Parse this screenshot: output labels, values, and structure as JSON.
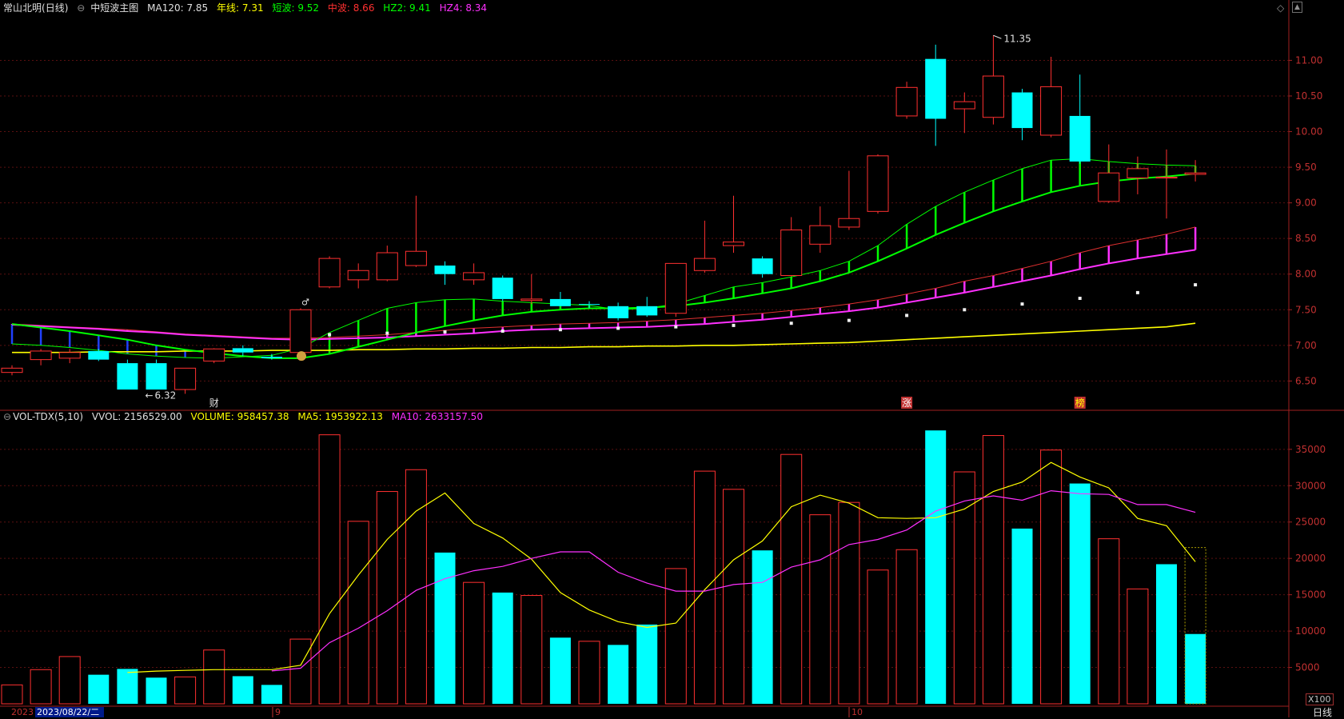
{
  "header": {
    "stock": "常山北明",
    "period": "(日线)",
    "indicator": "中短波主图",
    "ma120": {
      "label": "MA120:",
      "value": "7.85",
      "color": "#e0e0e0"
    },
    "nianxian": {
      "label": "年线:",
      "value": "7.31",
      "color": "#ffff00"
    },
    "duanbo": {
      "label": "短波:",
      "value": "9.52",
      "color": "#00ff00"
    },
    "zhongbo": {
      "label": "中波:",
      "value": "8.66",
      "color": "#ff3030"
    },
    "hz2": {
      "label": "HZ2:",
      "value": "9.41",
      "color": "#00ff00"
    },
    "hz4": {
      "label": "HZ4:",
      "value": "8.34",
      "color": "#ff30ff"
    }
  },
  "vol_header": {
    "name": "VOL-TDX(5,10)",
    "vvol": "VVOL: 2156529.00",
    "volume": {
      "text": "VOLUME: 958457.38",
      "color": "#ffff00"
    },
    "ma5": {
      "text": "MA5: 1953922.13",
      "color": "#ffff00"
    },
    "ma10": {
      "text": "MA10: 2633157.50",
      "color": "#ff30ff"
    }
  },
  "corner": {
    "scale": "X100",
    "period_label": "日线"
  },
  "annotations": {
    "high": "11.35",
    "low": "6.32",
    "marks": [
      "财",
      "涨",
      "榜"
    ]
  },
  "date_axis": {
    "start": "2023",
    "cursor_date": "2023/08/22/二",
    "month_9": "9",
    "month_10": "10"
  },
  "chart_data": [
    {
      "type": "candlestick",
      "ylim": [
        6.1,
        11.6
      ],
      "y_ticks": [
        "6.50",
        "7.00",
        "7.50",
        "8.00",
        "8.50",
        "9.00",
        "9.50",
        "10.00",
        "10.50",
        "11.00"
      ],
      "candles": [
        {
          "o": 6.62,
          "h": 6.72,
          "l": 6.58,
          "c": 6.68
        },
        {
          "o": 6.8,
          "h": 6.95,
          "l": 6.72,
          "c": 6.92
        },
        {
          "o": 6.82,
          "h": 6.95,
          "l": 6.75,
          "c": 6.9
        },
        {
          "o": 6.92,
          "h": 6.95,
          "l": 6.78,
          "c": 6.8
        },
        {
          "o": 6.75,
          "h": 6.8,
          "l": 6.38,
          "c": 6.38
        },
        {
          "o": 6.75,
          "h": 6.8,
          "l": 6.38,
          "c": 6.38
        },
        {
          "o": 6.38,
          "h": 6.68,
          "l": 6.32,
          "c": 6.68
        },
        {
          "o": 6.78,
          "h": 6.96,
          "l": 6.75,
          "c": 6.95
        },
        {
          "o": 6.96,
          "h": 7.0,
          "l": 6.85,
          "c": 6.9
        },
        {
          "o": 6.84,
          "h": 6.88,
          "l": 6.8,
          "c": 6.82
        },
        {
          "o": 6.9,
          "h": 7.52,
          "l": 6.85,
          "c": 7.5
        },
        {
          "o": 7.82,
          "h": 8.25,
          "l": 7.8,
          "c": 8.22
        },
        {
          "o": 7.92,
          "h": 8.15,
          "l": 7.8,
          "c": 8.05
        },
        {
          "o": 7.92,
          "h": 8.4,
          "l": 7.9,
          "c": 8.3
        },
        {
          "o": 8.12,
          "h": 9.1,
          "l": 8.1,
          "c": 8.32
        },
        {
          "o": 8.12,
          "h": 8.18,
          "l": 7.85,
          "c": 8.0
        },
        {
          "o": 7.92,
          "h": 8.15,
          "l": 7.85,
          "c": 8.02
        },
        {
          "o": 7.95,
          "h": 7.98,
          "l": 7.62,
          "c": 7.65
        },
        {
          "o": 7.63,
          "h": 8.0,
          "l": 7.58,
          "c": 7.65
        },
        {
          "o": 7.65,
          "h": 7.75,
          "l": 7.55,
          "c": 7.55
        },
        {
          "o": 7.58,
          "h": 7.62,
          "l": 7.52,
          "c": 7.57
        },
        {
          "o": 7.55,
          "h": 7.6,
          "l": 7.35,
          "c": 7.38
        },
        {
          "o": 7.55,
          "h": 7.68,
          "l": 7.4,
          "c": 7.42
        },
        {
          "o": 7.45,
          "h": 8.15,
          "l": 7.4,
          "c": 8.15
        },
        {
          "o": 8.05,
          "h": 8.75,
          "l": 8.02,
          "c": 8.22
        },
        {
          "o": 8.4,
          "h": 9.1,
          "l": 8.3,
          "c": 8.45
        },
        {
          "o": 8.22,
          "h": 8.25,
          "l": 7.95,
          "c": 8.0
        },
        {
          "o": 7.98,
          "h": 8.8,
          "l": 7.96,
          "c": 8.62
        },
        {
          "o": 8.42,
          "h": 8.95,
          "l": 8.3,
          "c": 8.68
        },
        {
          "o": 8.66,
          "h": 9.45,
          "l": 8.62,
          "c": 8.78
        },
        {
          "o": 8.88,
          "h": 9.68,
          "l": 8.85,
          "c": 9.66
        },
        {
          "o": 10.22,
          "h": 10.7,
          "l": 10.18,
          "c": 10.62
        },
        {
          "o": 11.02,
          "h": 11.22,
          "l": 9.8,
          "c": 10.18
        },
        {
          "o": 10.32,
          "h": 10.55,
          "l": 9.98,
          "c": 10.42
        },
        {
          "o": 10.2,
          "h": 11.35,
          "l": 10.1,
          "c": 10.78
        },
        {
          "o": 10.55,
          "h": 10.6,
          "l": 9.88,
          "c": 10.05
        },
        {
          "o": 9.95,
          "h": 11.05,
          "l": 9.92,
          "c": 10.63
        },
        {
          "o": 10.22,
          "h": 10.8,
          "l": 9.55,
          "c": 9.58
        },
        {
          "o": 9.02,
          "h": 9.82,
          "l": 9.0,
          "c": 9.42
        },
        {
          "o": 9.35,
          "h": 9.65,
          "l": 9.12,
          "c": 9.48
        },
        {
          "o": 9.35,
          "h": 9.75,
          "l": 8.78,
          "c": 9.36
        },
        {
          "o": 9.4,
          "h": 9.6,
          "l": 9.3,
          "c": 9.42
        }
      ],
      "series": {
        "nianxian": [
          6.9,
          6.9,
          6.9,
          6.91,
          6.91,
          6.91,
          6.92,
          6.92,
          6.92,
          6.93,
          6.93,
          6.93,
          6.94,
          6.94,
          6.95,
          6.95,
          6.96,
          6.96,
          6.97,
          6.97,
          6.98,
          6.98,
          6.99,
          6.99,
          7.0,
          7.0,
          7.01,
          7.02,
          7.03,
          7.04,
          7.06,
          7.08,
          7.1,
          7.12,
          7.14,
          7.16,
          7.18,
          7.2,
          7.22,
          7.24,
          7.26,
          7.31
        ],
        "ma120": [
          null,
          null,
          null,
          null,
          null,
          null,
          null,
          null,
          null,
          null,
          null,
          7.15,
          7.16,
          7.17,
          7.18,
          7.19,
          7.2,
          7.2,
          7.21,
          7.22,
          7.23,
          7.24,
          7.25,
          7.26,
          7.27,
          7.28,
          7.29,
          7.31,
          7.33,
          7.35,
          7.38,
          7.42,
          7.46,
          7.5,
          7.54,
          7.58,
          7.62,
          7.66,
          7.7,
          7.74,
          7.8,
          7.85
        ],
        "duanbo": [
          7.02,
          7.0,
          6.97,
          6.93,
          6.88,
          6.85,
          6.83,
          6.82,
          6.84,
          6.86,
          6.96,
          7.18,
          7.35,
          7.52,
          7.6,
          7.64,
          7.65,
          7.62,
          7.6,
          7.58,
          7.56,
          7.5,
          7.52,
          7.58,
          7.7,
          7.82,
          7.88,
          7.96,
          8.05,
          8.18,
          8.4,
          8.7,
          8.95,
          9.15,
          9.32,
          9.48,
          9.6,
          9.62,
          9.58,
          9.55,
          9.53,
          9.52
        ],
        "hz2": [
          7.3,
          7.25,
          7.2,
          7.14,
          7.08,
          7.0,
          6.94,
          6.89,
          6.85,
          6.82,
          6.82,
          6.88,
          6.98,
          7.08,
          7.18,
          7.27,
          7.35,
          7.42,
          7.47,
          7.5,
          7.52,
          7.52,
          7.53,
          7.55,
          7.6,
          7.66,
          7.73,
          7.8,
          7.9,
          8.02,
          8.18,
          8.36,
          8.55,
          8.72,
          8.88,
          9.02,
          9.15,
          9.24,
          9.3,
          9.34,
          9.37,
          9.41
        ],
        "zhongbo": [
          7.3,
          7.28,
          7.26,
          7.24,
          7.22,
          7.19,
          7.16,
          7.14,
          7.12,
          7.1,
          7.1,
          7.11,
          7.13,
          7.15,
          7.18,
          7.21,
          7.24,
          7.26,
          7.28,
          7.3,
          7.31,
          7.32,
          7.34,
          7.36,
          7.39,
          7.42,
          7.45,
          7.49,
          7.53,
          7.58,
          7.64,
          7.72,
          7.8,
          7.9,
          7.98,
          8.08,
          8.18,
          8.3,
          8.4,
          8.48,
          8.56,
          8.66
        ],
        "hz4": [
          7.29,
          7.27,
          7.25,
          7.23,
          7.2,
          7.18,
          7.15,
          7.13,
          7.11,
          7.09,
          7.08,
          7.09,
          7.1,
          7.11,
          7.13,
          7.15,
          7.17,
          7.2,
          7.22,
          7.23,
          7.24,
          7.25,
          7.26,
          7.28,
          7.3,
          7.33,
          7.36,
          7.4,
          7.44,
          7.48,
          7.53,
          7.6,
          7.67,
          7.74,
          7.82,
          7.9,
          7.98,
          8.07,
          8.15,
          8.22,
          8.28,
          8.34
        ]
      }
    },
    {
      "type": "bar",
      "title": "VOL-TDX(5,10)",
      "ylim": [
        0,
        38500
      ],
      "y_ticks": [
        "5000",
        "10000",
        "15000",
        "20000",
        "25000",
        "30000",
        "35000"
      ],
      "volumes": [
        2600,
        4700,
        6500,
        4000,
        4800,
        3600,
        3700,
        7400,
        3800,
        2600,
        8900,
        37000,
        25100,
        29200,
        32200,
        20800,
        16700,
        15300,
        14900,
        9100,
        8600,
        8100,
        10900,
        18600,
        32000,
        29500,
        21100,
        34300,
        26000,
        27700,
        18400,
        21200,
        37600,
        31900,
        36900,
        24100,
        34900,
        30300,
        22700,
        15800,
        19200,
        9600
      ],
      "ma5": [
        null,
        null,
        null,
        null,
        4300,
        4500,
        4600,
        4700,
        4700,
        4700,
        5300,
        12400,
        17700,
        22600,
        26500,
        29000,
        24800,
        22800,
        19900,
        15300,
        12900,
        11300,
        10500,
        11100,
        15700,
        19800,
        22400,
        27100,
        28700,
        27600,
        25600,
        25500,
        25600,
        26800,
        29200,
        30500,
        33200,
        31200,
        29700,
        25500,
        24500,
        19540
      ],
      "ma10": [
        null,
        null,
        null,
        null,
        null,
        null,
        null,
        null,
        null,
        4520,
        4900,
        8400,
        10400,
        12800,
        15600,
        17200,
        18300,
        18900,
        20000,
        20900,
        20900,
        18100,
        16600,
        15500,
        15500,
        16400,
        16700,
        18800,
        19800,
        21900,
        22600,
        23900,
        26500,
        27900,
        28600,
        28000,
        29300,
        28900,
        28800,
        27400,
        27400,
        26331
      ],
      "up": [
        true,
        true,
        true,
        false,
        false,
        false,
        true,
        true,
        false,
        false,
        true,
        true,
        true,
        true,
        true,
        false,
        true,
        false,
        true,
        false,
        true,
        false,
        false,
        true,
        true,
        true,
        false,
        true,
        true,
        true,
        true,
        true,
        false,
        true,
        true,
        false,
        true,
        false,
        true,
        true,
        false,
        false
      ]
    }
  ]
}
